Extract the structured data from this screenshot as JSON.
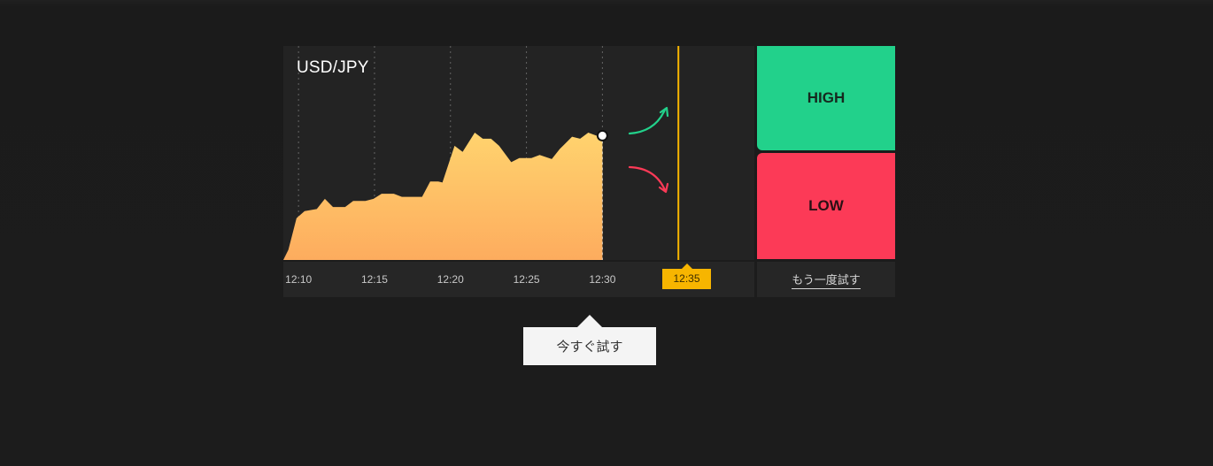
{
  "chart": {
    "pair": "USD/JPY",
    "tick_labels": [
      "12:10",
      "12:15",
      "12:20",
      "12:25",
      "12:30"
    ],
    "expiry_label": "12:35",
    "colors": {
      "area_top": "#ffd36e",
      "area_bottom": "#fdac5e",
      "up_arrow": "#22d18b",
      "down_arrow": "#fc3a57",
      "expiry_line": "#f7b500"
    },
    "icons": {
      "up": "curved-arrow-up-right",
      "down": "curved-arrow-down-right",
      "current": "current-price-dot"
    }
  },
  "chart_data": {
    "type": "area",
    "x_unit": "minutes since 12:00",
    "x": [
      9.33,
      9.87,
      10.4,
      11.2,
      11.73,
      12.27,
      13.07,
      13.6,
      14.4,
      14.93,
      15.47,
      16.27,
      16.8,
      17.6,
      18.13,
      18.67,
      19.2,
      19.47,
      20.27,
      20.8,
      21.6,
      22.13,
      22.67,
      23.2,
      24,
      24.53,
      25.33,
      25.87,
      26.67,
      27.2,
      28,
      28.53,
      29.07,
      29.6,
      30
    ],
    "values": [
      0,
      0.31,
      0.38,
      0.4,
      0.5,
      0.42,
      0.42,
      0.48,
      0.48,
      0.5,
      0.55,
      0.55,
      0.52,
      0.52,
      0.52,
      0.67,
      0.67,
      0.66,
      1.02,
      0.96,
      1.15,
      1.09,
      1.09,
      1.02,
      0.86,
      0.9,
      0.9,
      0.93,
      0.89,
      0.99,
      1.11,
      1.09,
      1.15,
      1.12,
      1.12,
      1.17,
      1.17
    ],
    "xlim": [
      9,
      40
    ],
    "ylim": [
      -0.1,
      2
    ],
    "x_ticks": [
      "12:10",
      "12:15",
      "12:20",
      "12:25",
      "12:30"
    ],
    "expiry": "12:35",
    "grid": true,
    "legend": "none"
  },
  "buttons": {
    "high": "HIGH",
    "low": "LOW",
    "retry": "もう一度試す",
    "try_now": "今すぐ試す"
  }
}
